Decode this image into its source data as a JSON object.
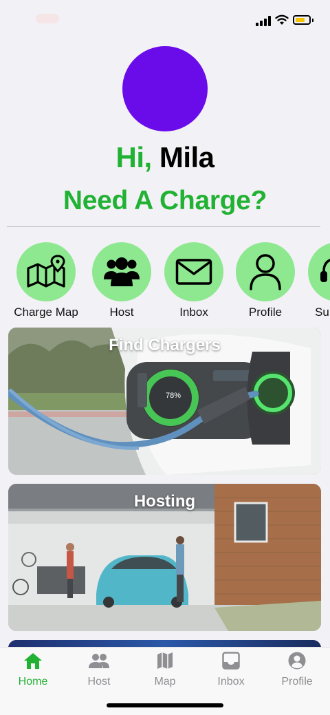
{
  "greeting": {
    "hi": "Hi,",
    "name": "Mila"
  },
  "subtitle": "Need A Charge?",
  "shortcuts": [
    {
      "label": "Charge Map",
      "icon": "map-pin-icon"
    },
    {
      "label": "Host",
      "icon": "users-icon"
    },
    {
      "label": "Inbox",
      "icon": "envelope-icon"
    },
    {
      "label": "Profile",
      "icon": "person-icon"
    },
    {
      "label": "Su",
      "icon": "headset-icon"
    }
  ],
  "cards": [
    {
      "title": "Find Chargers",
      "charge_readout": "78%"
    },
    {
      "title": "Hosting"
    }
  ],
  "tabs": [
    {
      "label": "Home",
      "icon": "home-icon",
      "active": true
    },
    {
      "label": "Host",
      "icon": "people-icon",
      "active": false
    },
    {
      "label": "Map",
      "icon": "map-icon",
      "active": false
    },
    {
      "label": "Inbox",
      "icon": "inbox-icon",
      "active": false
    },
    {
      "label": "Profile",
      "icon": "account-circle-icon",
      "active": false
    }
  ],
  "colors": {
    "accent": "#21b233",
    "avatar": "#6a0ce9",
    "shortcut_bg": "#8de88f",
    "tab_inactive": "#8e8e93",
    "battery": "#f5c400"
  },
  "status": {
    "battery_level": 0.7,
    "signal_bars": 4
  }
}
